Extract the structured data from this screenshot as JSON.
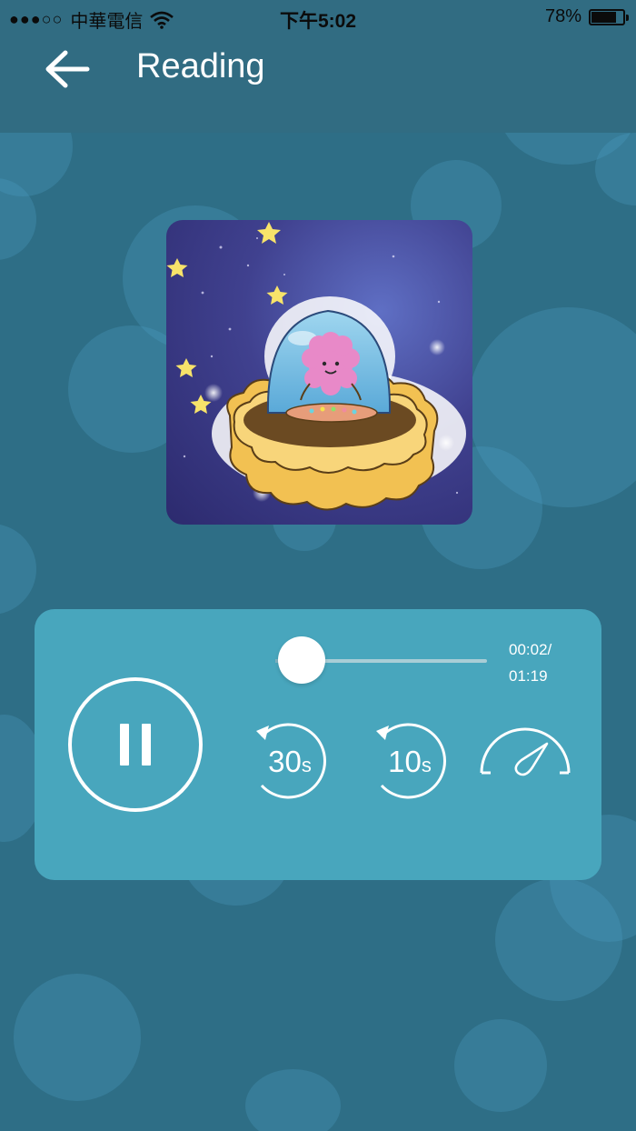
{
  "status_bar": {
    "carrier": "中華電信",
    "signal_dots": "●●●○○",
    "time": "下午5:02",
    "battery_percent": "78%",
    "battery_level": 0.78,
    "wifi_icon": "wifi-icon"
  },
  "header": {
    "back_icon": "arrow-left-icon",
    "title": "Reading"
  },
  "player": {
    "progress": 0.03,
    "current_time": "00:02/",
    "total_time": "01:19",
    "buttons": {
      "pause": "pause-icon",
      "rewind_30_label": "30",
      "rewind_30_unit": "s",
      "rewind_10_label": "10",
      "rewind_10_unit": "s",
      "speed": "speedometer-icon"
    }
  },
  "colors": {
    "background": "#2e6e86",
    "header": "#316c82",
    "panel": "#48a6bd",
    "cover_bg": "#40418f",
    "mooncake": "#f2c152"
  }
}
